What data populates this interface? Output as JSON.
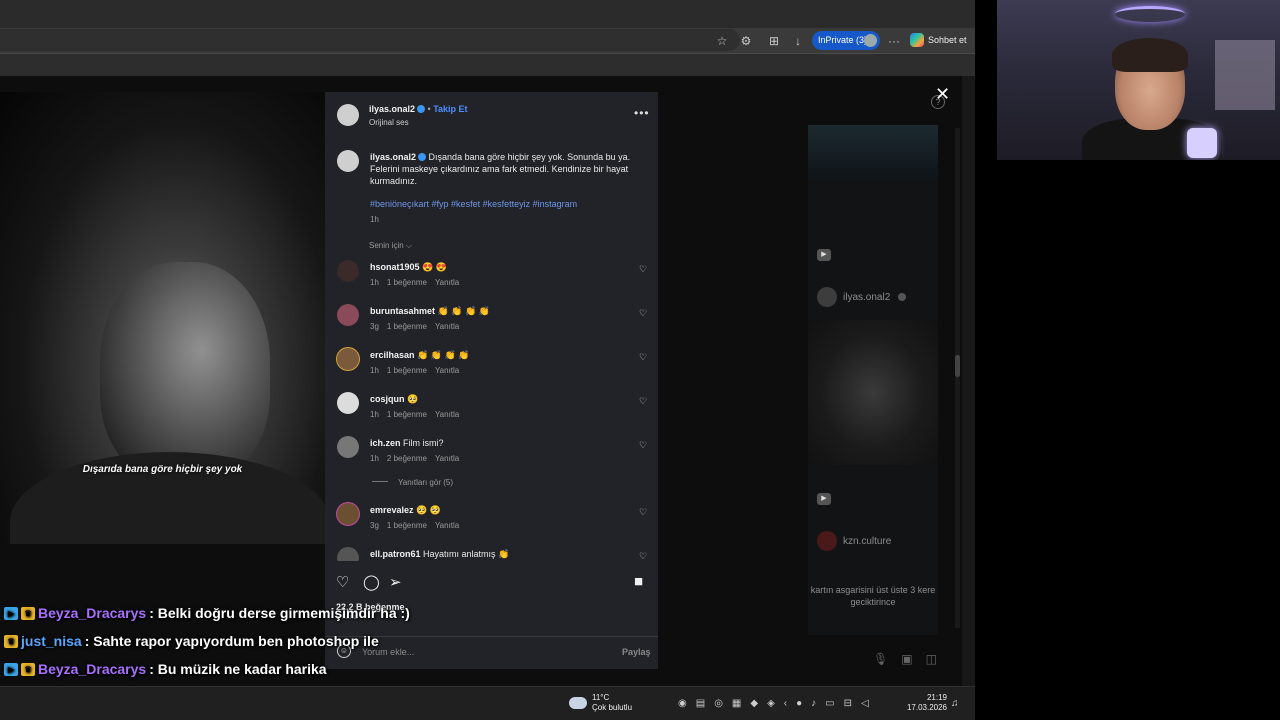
{
  "browser": {
    "window_controls": [
      "—",
      "❐",
      "✕"
    ],
    "inprivate_label": "InPrivate (3)",
    "copilot_label": "Sohbet et",
    "more_label": "···"
  },
  "post": {
    "username": "ilyas.onal2",
    "follow_label": "Takip Et",
    "audio_label": "Orijinal ses",
    "caption": "Dışanda bana göre hiçbir şey yok. Sonunda bu ya. Felerini maskeye çıkardınız ama fark etmedi. Kendinize bir hayat kurmadınız.",
    "hashtags": "#beniöneçıkart #fyp #kesfet #kesfetteyiz #instagram",
    "time": "1h",
    "sort_label": "Senin için",
    "video_subtitle": "Dışarıda bana göre hiçbir şey yok",
    "likes_text": "22,2 B beğenme",
    "ago_text": "3 hafta",
    "comment_placeholder": "Yorum ekle...",
    "share_label": "Paylaş"
  },
  "comments": [
    {
      "user": "hsonat1905",
      "text": "😍 😍",
      "time": "1h",
      "likes": "1 beğenme",
      "reply": "Yanıtla",
      "avatar_color": "#3a2a2a"
    },
    {
      "user": "buruntasahmet",
      "text": "👏 👏 👏 👏",
      "time": "3g",
      "likes": "1 beğenme",
      "reply": "Yanıtla",
      "avatar_color": "#8a4a5a"
    },
    {
      "user": "ercilhasan",
      "text": "👏 👏 👏 👏",
      "time": "1h",
      "likes": "1 beğenme",
      "reply": "Yanıtla",
      "avatar_color": "#7a5a3a"
    },
    {
      "user": "cosjqun",
      "text": "🥺",
      "time": "1h",
      "likes": "1 beğenme",
      "reply": "Yanıtla",
      "avatar_color": "#dcdcdc"
    },
    {
      "user": "ich.zen",
      "text": "Film ismi?",
      "time": "1h",
      "likes": "2 beğenme",
      "reply": "Yanıtla",
      "avatar_color": "#777777"
    },
    {
      "user": "emrevalez",
      "text": "🥺 🥺",
      "time": "3g",
      "likes": "1 beğenme",
      "reply": "Yanıtla",
      "avatar_color": "#6a5030"
    },
    {
      "user": "ell.patron61",
      "text": "Hayatımı anlatmış 👏",
      "time": "",
      "likes": "",
      "reply": "",
      "avatar_color": "#555555"
    }
  ],
  "view_replies": "Yanıtları gör (5)",
  "side": {
    "user1": "ilyas.onal2",
    "user2": "kzn.culture",
    "caption": "kartın asgarisini üst üste 3 kere geciktirince"
  },
  "chat": [
    {
      "name": "Beyza_Dracarys",
      "message": ": Belki doğru derse girmemişimdir ha :)",
      "name_color": "purple"
    },
    {
      "name": "just_nisa",
      "message": ": Sahte rapor yapıyordum ben photoshop ile",
      "name_color": "blue"
    },
    {
      "name": "Beyza_Dracarys",
      "message": ": Bu müzik ne kadar harika",
      "name_color": "purple"
    }
  ],
  "taskbar": {
    "temperature": "11°C",
    "weather_desc": "Çok bulutlu",
    "time": "21:19",
    "date": "17.03.2026"
  }
}
